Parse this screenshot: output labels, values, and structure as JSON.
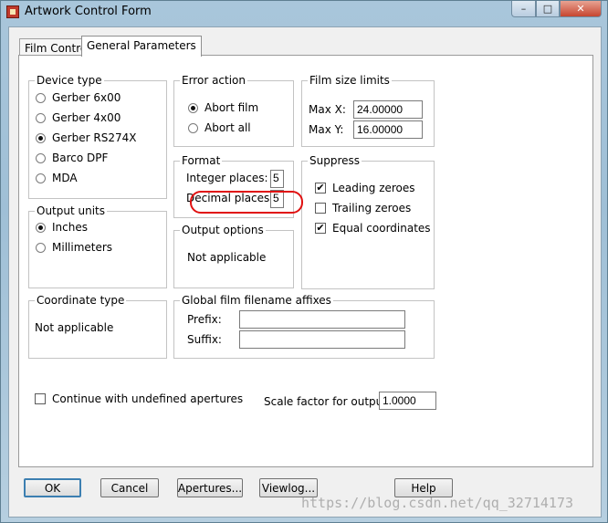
{
  "window": {
    "title": "Artwork Control Form",
    "buttons": {
      "minimize": "–",
      "maximize": "□",
      "close": "✕"
    }
  },
  "tabs": [
    {
      "label": "Film Control",
      "active": false
    },
    {
      "label": "General Parameters",
      "active": true
    }
  ],
  "device_type": {
    "title": "Device type",
    "options": [
      {
        "label": "Gerber 6x00",
        "selected": false
      },
      {
        "label": "Gerber 4x00",
        "selected": false
      },
      {
        "label": "Gerber RS274X",
        "selected": true
      },
      {
        "label": "Barco DPF",
        "selected": false
      },
      {
        "label": "MDA",
        "selected": false
      }
    ]
  },
  "error_action": {
    "title": "Error action",
    "options": [
      {
        "label": "Abort film",
        "selected": true
      },
      {
        "label": "Abort all",
        "selected": false
      }
    ]
  },
  "film_size_limits": {
    "title": "Film size limits",
    "max_x_label": "Max X:",
    "max_x_value": "24.00000",
    "max_y_label": "Max Y:",
    "max_y_value": "16.00000"
  },
  "format": {
    "title": "Format",
    "integer_label": "Integer places:",
    "integer_value": "5",
    "decimal_label": "Decimal places:",
    "decimal_value": "5"
  },
  "suppress": {
    "title": "Suppress",
    "options": [
      {
        "label": "Leading zeroes",
        "checked": true
      },
      {
        "label": "Trailing zeroes",
        "checked": false
      },
      {
        "label": "Equal coordinates",
        "checked": true
      }
    ]
  },
  "output_units": {
    "title": "Output units",
    "options": [
      {
        "label": "Inches",
        "selected": true
      },
      {
        "label": "Millimeters",
        "selected": false
      }
    ]
  },
  "output_options": {
    "title": "Output options",
    "text": "Not applicable"
  },
  "coordinate_type": {
    "title": "Coordinate type",
    "text": "Not applicable"
  },
  "global_affixes": {
    "title": "Global film filename affixes",
    "prefix_label": "Prefix:",
    "prefix_value": "",
    "suffix_label": "Suffix:",
    "suffix_value": ""
  },
  "continue_undefined": {
    "label": "Continue with undefined apertures",
    "checked": false
  },
  "scale": {
    "label": "Scale factor for output:",
    "value": "1.0000"
  },
  "footer_buttons": {
    "ok": "OK",
    "cancel": "Cancel",
    "apertures": "Apertures...",
    "viewlog": "Viewlog...",
    "help": "Help"
  },
  "watermark": "https://blog.csdn.net/qq_32714173"
}
